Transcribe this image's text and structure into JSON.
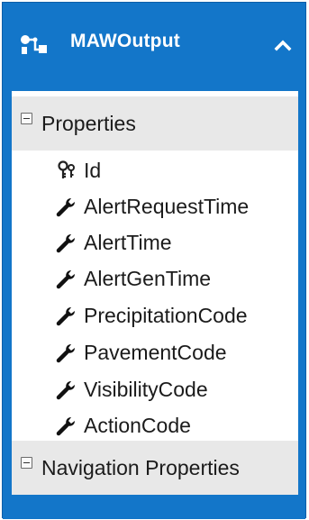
{
  "entity": {
    "title": "MAWOutput",
    "accent_color": "#1376c9",
    "icon": "entity-class-icon",
    "collapse_icon": "chevron-up-icon"
  },
  "sections": {
    "properties": {
      "label": "Properties",
      "toggle_icon": "collapse-minus-icon"
    },
    "navigation": {
      "label": "Navigation Properties",
      "toggle_icon": "collapse-minus-icon"
    }
  },
  "properties": [
    {
      "label": "Id",
      "icon": "key-icon"
    },
    {
      "label": "AlertRequestTime",
      "icon": "wrench-icon"
    },
    {
      "label": "AlertTime",
      "icon": "wrench-icon"
    },
    {
      "label": "AlertGenTime",
      "icon": "wrench-icon"
    },
    {
      "label": "PrecipitationCode",
      "icon": "wrench-icon"
    },
    {
      "label": "PavementCode",
      "icon": "wrench-icon"
    },
    {
      "label": "VisibilityCode",
      "icon": "wrench-icon"
    },
    {
      "label": "ActionCode",
      "icon": "wrench-icon"
    }
  ]
}
